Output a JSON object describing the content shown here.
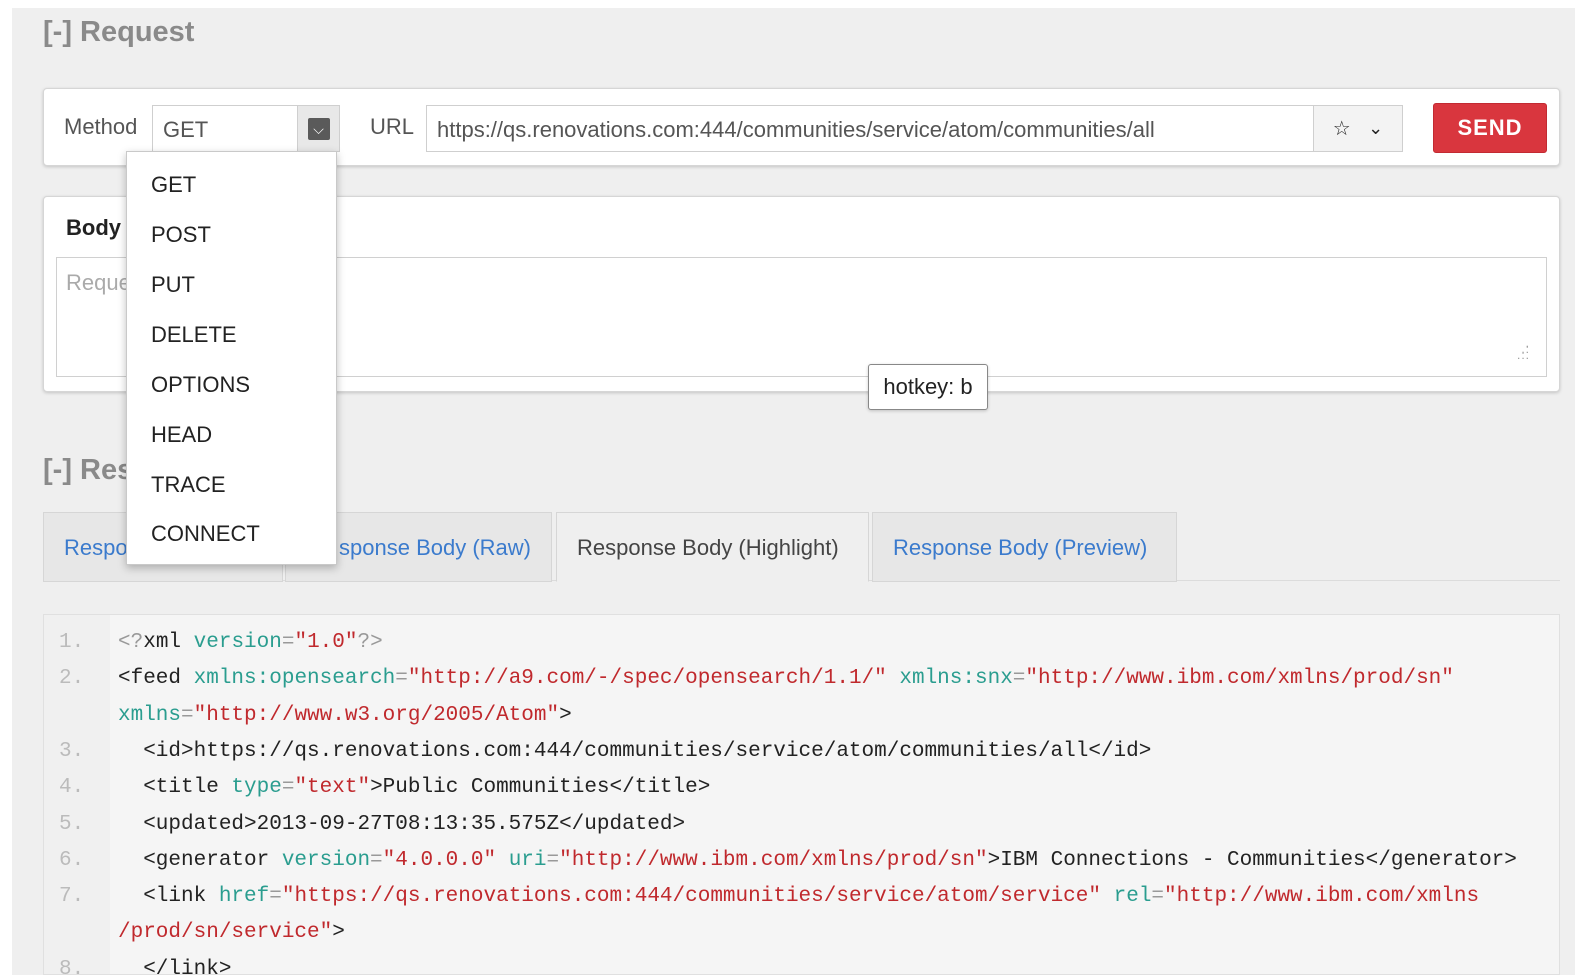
{
  "request": {
    "title": "Request",
    "toggle": "[-]",
    "method_label": "Method",
    "method_value": "GET",
    "url_label": "URL",
    "url_value": "https://qs.renovations.com:444/communities/service/atom/communities/all",
    "star_icon": "☆",
    "chevron_icon": "chevron-down",
    "send_label": "SEND",
    "body_label": "Body",
    "body_placeholder": "Reque"
  },
  "tooltip": "hotkey: b",
  "method_dropdown": {
    "options": [
      "GET",
      "POST",
      "PUT",
      "DELETE",
      "OPTIONS",
      "HEAD",
      "TRACE",
      "CONNECT"
    ]
  },
  "response": {
    "title": "Res",
    "toggle": "[-]",
    "tabs": [
      {
        "label": "Respo",
        "active": false
      },
      {
        "label": "sponse Body (Raw)",
        "active": false
      },
      {
        "label": "Response Body (Highlight)",
        "active": true
      },
      {
        "label": "Response Body (Preview)",
        "active": false
      }
    ]
  },
  "code": {
    "lines": [
      {
        "n": "1.",
        "parts": [
          [
            "pi",
            "<?"
          ],
          [
            "tag",
            "xml "
          ],
          [
            "attr",
            "version"
          ],
          [
            "pi",
            "="
          ],
          [
            "str",
            "\"1.0\""
          ],
          [
            "pi",
            "?>"
          ]
        ]
      },
      {
        "n": "2.",
        "parts": [
          [
            "tag",
            "<feed "
          ],
          [
            "attr",
            "xmlns:opensearch"
          ],
          [
            "pi",
            "="
          ],
          [
            "str",
            "\"http://a9.com/-/spec/opensearch/1.1/\""
          ],
          [
            "tag",
            " "
          ],
          [
            "attr",
            "xmlns:snx"
          ],
          [
            "pi",
            "="
          ],
          [
            "str",
            "\"http://www.ibm.com/xmlns/prod/sn\""
          ]
        ]
      },
      {
        "n": "",
        "parts": [
          [
            "attr",
            "xmlns"
          ],
          [
            "pi",
            "="
          ],
          [
            "str",
            "\"http://www.w3.org/2005/Atom\""
          ],
          [
            "tag",
            ">"
          ]
        ]
      },
      {
        "n": "3.",
        "parts": [
          [
            "tag",
            "  <id>https://qs.renovations.com:444/communities/service/atom/communities/all</id>"
          ]
        ]
      },
      {
        "n": "4.",
        "parts": [
          [
            "tag",
            "  <title "
          ],
          [
            "attr",
            "type"
          ],
          [
            "pi",
            "="
          ],
          [
            "str",
            "\"text\""
          ],
          [
            "tag",
            ">Public Communities</title>"
          ]
        ]
      },
      {
        "n": "5.",
        "parts": [
          [
            "tag",
            "  <updated>2013-09-27T08:13:35.575Z</updated>"
          ]
        ]
      },
      {
        "n": "6.",
        "parts": [
          [
            "tag",
            "  <generator "
          ],
          [
            "attr",
            "version"
          ],
          [
            "pi",
            "="
          ],
          [
            "str",
            "\"4.0.0.0\""
          ],
          [
            "tag",
            " "
          ],
          [
            "attr",
            "uri"
          ],
          [
            "pi",
            "="
          ],
          [
            "str",
            "\"http://www.ibm.com/xmlns/prod/sn\""
          ],
          [
            "tag",
            ">IBM Connections - Communities</generator>"
          ]
        ]
      },
      {
        "n": "7.",
        "parts": [
          [
            "tag",
            "  <link "
          ],
          [
            "attr",
            "href"
          ],
          [
            "pi",
            "="
          ],
          [
            "str",
            "\"https://qs.renovations.com:444/communities/service/atom/service\""
          ],
          [
            "tag",
            " "
          ],
          [
            "attr",
            "rel"
          ],
          [
            "pi",
            "="
          ],
          [
            "str",
            "\"http://www.ibm.com/xmlns"
          ]
        ]
      },
      {
        "n": "",
        "parts": [
          [
            "str",
            "/prod/sn/service\""
          ],
          [
            "tag",
            ">"
          ]
        ]
      },
      {
        "n": "8.",
        "parts": [
          [
            "tag",
            "  </link>"
          ]
        ]
      }
    ]
  }
}
